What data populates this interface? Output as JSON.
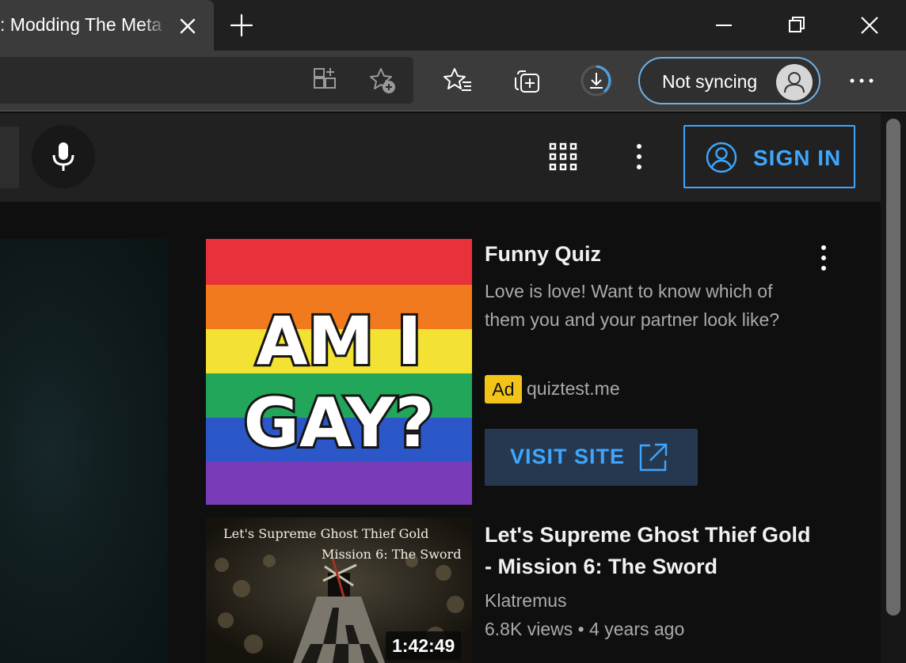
{
  "browser": {
    "tab": {
      "title": ": Modding The Meta"
    },
    "profile": {
      "sync_label": "Not syncing"
    }
  },
  "masthead": {
    "sign_in_label": "SIGN IN"
  },
  "ad": {
    "thumbnail_text_line1": "AM I",
    "thumbnail_text_line2": "GAY?",
    "title": "Funny Quiz",
    "description": "Love is love! Want to know which of them you and your partner look like?",
    "badge": "Ad",
    "domain": "quiztest.me",
    "cta_label": "VISIT SITE"
  },
  "video": {
    "thumbnail_caption_line1": "Let's Supreme Ghost Thief Gold",
    "thumbnail_caption_line2": "Mission 6: The Sword",
    "duration": "1:42:49",
    "title": "Let's Supreme Ghost Thief Gold - Mission 6: The Sword",
    "channel": "Klatremus",
    "meta": "6.8K views • 4 years ago"
  },
  "colors": {
    "accent_blue": "#3ea6ff",
    "ad_badge": "#f2c318",
    "sync_border": "#6fb0e6"
  },
  "icons": {
    "tab_close": "close-icon",
    "new_tab": "plus-icon",
    "minimize": "minimize-icon",
    "restore": "restore-icon",
    "window_close": "close-icon",
    "apps_in_bar": "apps-add-icon",
    "add_favorite": "star-plus-icon",
    "favorites": "star-list-icon",
    "collections": "collections-icon",
    "downloads": "download-icon",
    "profile": "person-icon",
    "settings_more": "more-horizontal-icon",
    "voice_search": "microphone-icon",
    "youtube_apps": "grid-icon",
    "settings": "more-vertical-icon",
    "sign_in": "account-circle-icon",
    "visit_site": "open-external-icon",
    "ad_menu": "more-vertical-icon"
  }
}
